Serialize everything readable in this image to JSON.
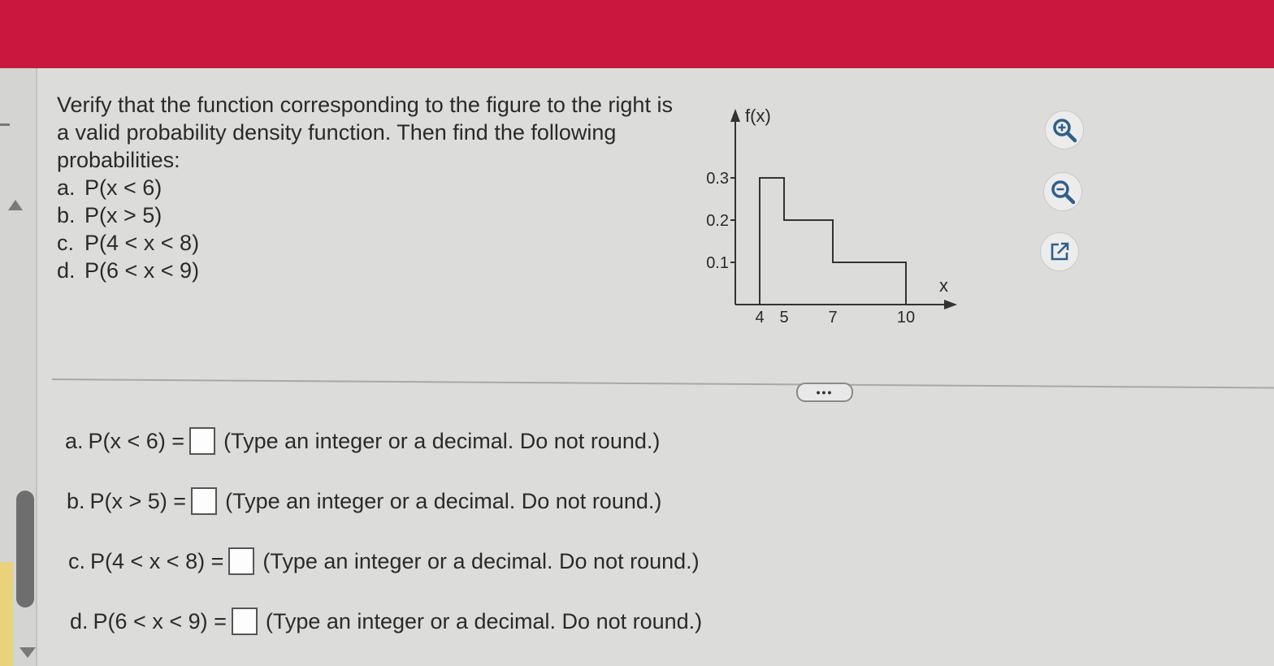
{
  "question": {
    "intro": "Verify that the function corresponding to the figure to the right is a valid probability density function. Then find the following probabilities:",
    "items": [
      {
        "letter": "a.",
        "expr": "P(x < 6)"
      },
      {
        "letter": "b.",
        "expr": "P(x > 5)"
      },
      {
        "letter": "c.",
        "expr": "P(4 < x < 8)"
      },
      {
        "letter": "d.",
        "expr": "P(6 < x < 9)"
      }
    ]
  },
  "chart_data": {
    "type": "area",
    "title": "",
    "ylabel": "f(x)",
    "xlabel": "x",
    "x_ticks": [
      "4",
      "5",
      "7",
      "10"
    ],
    "y_ticks": [
      "0.1",
      "0.2",
      "0.3"
    ],
    "segments": [
      {
        "x0": 4,
        "x1": 5,
        "y": 0.3
      },
      {
        "x0": 5,
        "x1": 7,
        "y": 0.2
      },
      {
        "x0": 7,
        "x1": 10,
        "y": 0.1
      }
    ],
    "xlim": [
      3,
      12.1
    ],
    "ylim": [
      0,
      0.4
    ],
    "grid": false
  },
  "tools": {
    "zoom_in": "zoom-in-icon",
    "zoom_out": "zoom-out-icon",
    "popout": "external-link-icon"
  },
  "more_button": "•••",
  "answers": [
    {
      "letter": "a.",
      "expr": "P(x < 6) =",
      "hint": "(Type an integer or a decimal. Do not round.)",
      "value": ""
    },
    {
      "letter": "b.",
      "expr": "P(x > 5) =",
      "hint": "(Type an integer or a decimal. Do not round.)",
      "value": ""
    },
    {
      "letter": "c.",
      "expr": "P(4 < x < 8) =",
      "hint": "(Type an integer or a decimal. Do not round.)",
      "value": ""
    },
    {
      "letter": "d.",
      "expr": "P(6 < x < 9) =",
      "hint": "(Type an integer or a decimal. Do not round.)",
      "value": ""
    }
  ]
}
